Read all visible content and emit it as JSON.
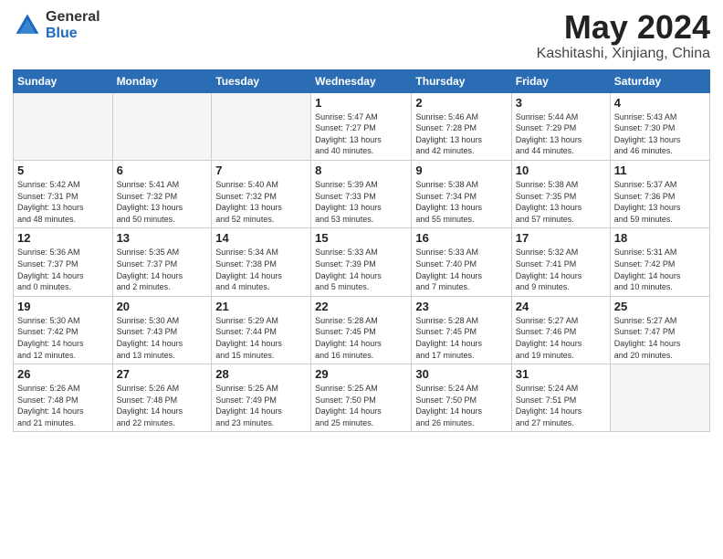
{
  "logo": {
    "general": "General",
    "blue": "Blue"
  },
  "title": "May 2024",
  "location": "Kashitashi, Xinjiang, China",
  "days_of_week": [
    "Sunday",
    "Monday",
    "Tuesday",
    "Wednesday",
    "Thursday",
    "Friday",
    "Saturday"
  ],
  "weeks": [
    [
      {
        "day": "",
        "info": ""
      },
      {
        "day": "",
        "info": ""
      },
      {
        "day": "",
        "info": ""
      },
      {
        "day": "1",
        "info": "Sunrise: 5:47 AM\nSunset: 7:27 PM\nDaylight: 13 hours\nand 40 minutes."
      },
      {
        "day": "2",
        "info": "Sunrise: 5:46 AM\nSunset: 7:28 PM\nDaylight: 13 hours\nand 42 minutes."
      },
      {
        "day": "3",
        "info": "Sunrise: 5:44 AM\nSunset: 7:29 PM\nDaylight: 13 hours\nand 44 minutes."
      },
      {
        "day": "4",
        "info": "Sunrise: 5:43 AM\nSunset: 7:30 PM\nDaylight: 13 hours\nand 46 minutes."
      }
    ],
    [
      {
        "day": "5",
        "info": "Sunrise: 5:42 AM\nSunset: 7:31 PM\nDaylight: 13 hours\nand 48 minutes."
      },
      {
        "day": "6",
        "info": "Sunrise: 5:41 AM\nSunset: 7:32 PM\nDaylight: 13 hours\nand 50 minutes."
      },
      {
        "day": "7",
        "info": "Sunrise: 5:40 AM\nSunset: 7:32 PM\nDaylight: 13 hours\nand 52 minutes."
      },
      {
        "day": "8",
        "info": "Sunrise: 5:39 AM\nSunset: 7:33 PM\nDaylight: 13 hours\nand 53 minutes."
      },
      {
        "day": "9",
        "info": "Sunrise: 5:38 AM\nSunset: 7:34 PM\nDaylight: 13 hours\nand 55 minutes."
      },
      {
        "day": "10",
        "info": "Sunrise: 5:38 AM\nSunset: 7:35 PM\nDaylight: 13 hours\nand 57 minutes."
      },
      {
        "day": "11",
        "info": "Sunrise: 5:37 AM\nSunset: 7:36 PM\nDaylight: 13 hours\nand 59 minutes."
      }
    ],
    [
      {
        "day": "12",
        "info": "Sunrise: 5:36 AM\nSunset: 7:37 PM\nDaylight: 14 hours\nand 0 minutes."
      },
      {
        "day": "13",
        "info": "Sunrise: 5:35 AM\nSunset: 7:37 PM\nDaylight: 14 hours\nand 2 minutes."
      },
      {
        "day": "14",
        "info": "Sunrise: 5:34 AM\nSunset: 7:38 PM\nDaylight: 14 hours\nand 4 minutes."
      },
      {
        "day": "15",
        "info": "Sunrise: 5:33 AM\nSunset: 7:39 PM\nDaylight: 14 hours\nand 5 minutes."
      },
      {
        "day": "16",
        "info": "Sunrise: 5:33 AM\nSunset: 7:40 PM\nDaylight: 14 hours\nand 7 minutes."
      },
      {
        "day": "17",
        "info": "Sunrise: 5:32 AM\nSunset: 7:41 PM\nDaylight: 14 hours\nand 9 minutes."
      },
      {
        "day": "18",
        "info": "Sunrise: 5:31 AM\nSunset: 7:42 PM\nDaylight: 14 hours\nand 10 minutes."
      }
    ],
    [
      {
        "day": "19",
        "info": "Sunrise: 5:30 AM\nSunset: 7:42 PM\nDaylight: 14 hours\nand 12 minutes."
      },
      {
        "day": "20",
        "info": "Sunrise: 5:30 AM\nSunset: 7:43 PM\nDaylight: 14 hours\nand 13 minutes."
      },
      {
        "day": "21",
        "info": "Sunrise: 5:29 AM\nSunset: 7:44 PM\nDaylight: 14 hours\nand 15 minutes."
      },
      {
        "day": "22",
        "info": "Sunrise: 5:28 AM\nSunset: 7:45 PM\nDaylight: 14 hours\nand 16 minutes."
      },
      {
        "day": "23",
        "info": "Sunrise: 5:28 AM\nSunset: 7:45 PM\nDaylight: 14 hours\nand 17 minutes."
      },
      {
        "day": "24",
        "info": "Sunrise: 5:27 AM\nSunset: 7:46 PM\nDaylight: 14 hours\nand 19 minutes."
      },
      {
        "day": "25",
        "info": "Sunrise: 5:27 AM\nSunset: 7:47 PM\nDaylight: 14 hours\nand 20 minutes."
      }
    ],
    [
      {
        "day": "26",
        "info": "Sunrise: 5:26 AM\nSunset: 7:48 PM\nDaylight: 14 hours\nand 21 minutes."
      },
      {
        "day": "27",
        "info": "Sunrise: 5:26 AM\nSunset: 7:48 PM\nDaylight: 14 hours\nand 22 minutes."
      },
      {
        "day": "28",
        "info": "Sunrise: 5:25 AM\nSunset: 7:49 PM\nDaylight: 14 hours\nand 23 minutes."
      },
      {
        "day": "29",
        "info": "Sunrise: 5:25 AM\nSunset: 7:50 PM\nDaylight: 14 hours\nand 25 minutes."
      },
      {
        "day": "30",
        "info": "Sunrise: 5:24 AM\nSunset: 7:50 PM\nDaylight: 14 hours\nand 26 minutes."
      },
      {
        "day": "31",
        "info": "Sunrise: 5:24 AM\nSunset: 7:51 PM\nDaylight: 14 hours\nand 27 minutes."
      },
      {
        "day": "",
        "info": ""
      }
    ]
  ]
}
